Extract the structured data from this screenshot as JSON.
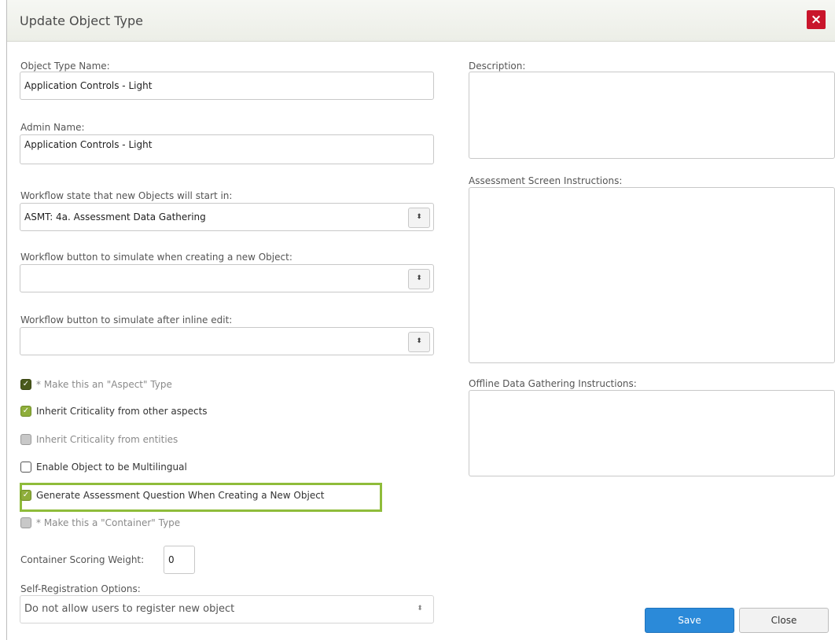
{
  "dialog": {
    "title": "Update Object Type",
    "close_icon": "close-icon",
    "close_glyph": "×",
    "accent_color": "#8fbc3a"
  },
  "fields": {
    "object_type_name": {
      "label": "Object Type Name:",
      "value": "Application Controls - Light"
    },
    "admin_name": {
      "label": "Admin Name:",
      "value": "Application Controls - Light"
    },
    "workflow_start_state": {
      "label": "Workflow state that new Objects will start in:",
      "value": "ASMT: 4a. Assessment Data Gathering"
    },
    "workflow_button_create": {
      "label": "Workflow button to simulate when creating a new Object:",
      "value": ""
    },
    "workflow_button_inline": {
      "label": "Workflow button to simulate after inline edit:",
      "value": ""
    },
    "container_scoring_weight": {
      "label": "Container Scoring Weight:",
      "value": "0"
    },
    "self_registration": {
      "label": "Self-Registration Options:",
      "value": "Do not allow users to register new object"
    },
    "description": {
      "label": "Description:"
    },
    "assessment_instructions": {
      "label": "Assessment Screen Instructions:"
    },
    "offline_instructions": {
      "label": "Offline Data Gathering Instructions:"
    }
  },
  "checkboxes": [
    {
      "label": "* Make this an \"Aspect\" Type",
      "checked": true,
      "disabled": true
    },
    {
      "label": "Inherit Criticality from other aspects",
      "checked": true,
      "disabled": false
    },
    {
      "label": "Inherit Criticality from entities",
      "checked": false,
      "disabled": true
    },
    {
      "label": "Enable Object to be Multilingual",
      "checked": false,
      "disabled": false
    },
    {
      "label": "Generate Assessment Question When Creating a New Object",
      "checked": true,
      "disabled": false,
      "highlighted": true
    },
    {
      "label": "* Make this a \"Container\" Type",
      "checked": false,
      "disabled": true
    }
  ],
  "select_arrow_glyph": "⬍",
  "check_glyph": "✓",
  "buttons": {
    "save": "Save",
    "close": "Close"
  }
}
